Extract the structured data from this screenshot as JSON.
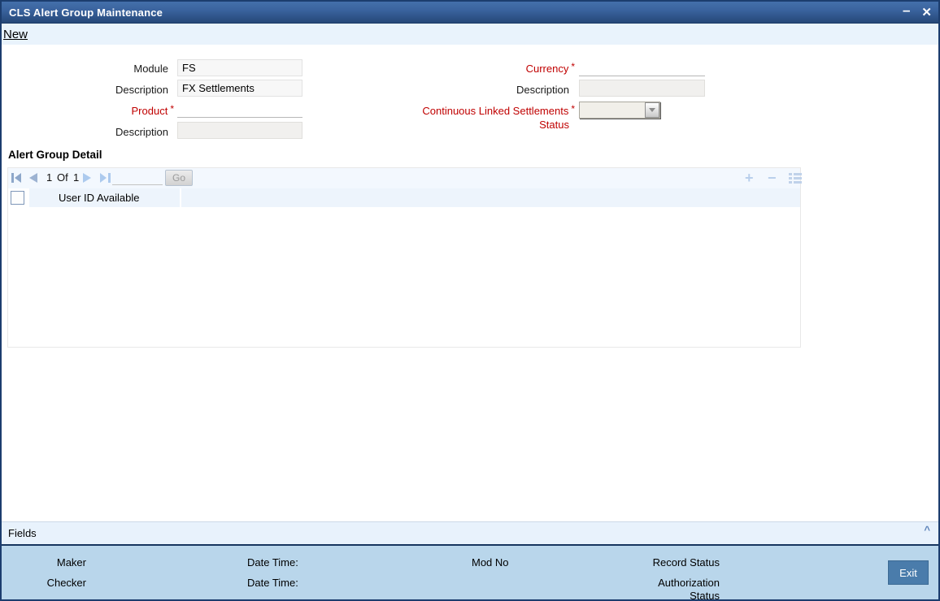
{
  "window": {
    "title": "CLS Alert Group Maintenance"
  },
  "icons": {
    "minimize": "–",
    "close": "✕",
    "add": "+",
    "remove": "−",
    "chevron_up": "^"
  },
  "menu": {
    "new_label": "New"
  },
  "form": {
    "asterisk": "*",
    "module": {
      "label": "Module",
      "value": "FS"
    },
    "module_description": {
      "label": "Description",
      "value": "FX Settlements"
    },
    "product": {
      "label": "Product",
      "value": ""
    },
    "product_description": {
      "label": "Description",
      "value": ""
    },
    "currency": {
      "label": "Currency",
      "value": ""
    },
    "currency_description": {
      "label": "Description",
      "value": ""
    },
    "cls_status": {
      "label_line1": "Continuous Linked Settlements",
      "label_line2": "Status",
      "value": ""
    }
  },
  "alert_group_detail": {
    "heading": "Alert Group Detail",
    "pagination": {
      "current_page": "1",
      "of_label": "Of",
      "total_pages": "1",
      "page_input_value": "",
      "go_label": "Go"
    },
    "columns": [
      {
        "label": "User ID Available"
      }
    ],
    "rows": []
  },
  "fields_bar": {
    "label": "Fields"
  },
  "footer": {
    "maker_label": "Maker",
    "checker_label": "Checker",
    "maker_datetime_label": "Date Time:",
    "checker_datetime_label": "Date Time:",
    "mod_no_label": "Mod No",
    "record_status_label": "Record Status",
    "auth_status_line1": "Authorization",
    "auth_status_line2": "Status",
    "exit_label": "Exit"
  },
  "colors": {
    "titlebar_blue": "#3a639e",
    "window_border": "#1c3d6e",
    "menubar_bg": "#e9f3fc",
    "required_red": "#c00000",
    "grid_toolbar_bg": "#f3f8fe",
    "grid_header_bg": "#edf4fc",
    "fields_bar_bg": "#e8f2fc",
    "footer_bg": "#b9d6eb",
    "exit_button_bg": "#4a7cab",
    "toolbar_icon_blue": "#b9cfec"
  }
}
